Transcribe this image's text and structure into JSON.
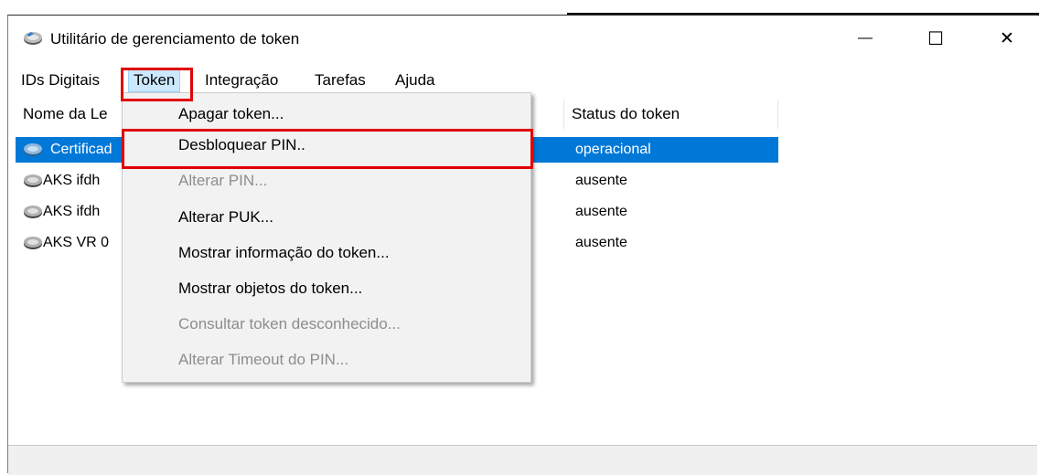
{
  "window": {
    "title": "Utilitário de gerenciamento de token",
    "app_icon": "token-icon",
    "controls": {
      "minimize": "—",
      "maximize": "☐",
      "close": "✕"
    }
  },
  "menubar": {
    "items": [
      {
        "label": "IDs Digitais"
      },
      {
        "label": "Token",
        "active": true
      },
      {
        "label": "Integração"
      },
      {
        "label": "Tarefas"
      },
      {
        "label": "Ajuda"
      }
    ]
  },
  "list": {
    "columns": [
      "Nome da Le",
      "Status do token"
    ],
    "rows": [
      {
        "name": "Certificad",
        "status": "operacional",
        "selected": true
      },
      {
        "name": "AKS ifdh",
        "status": "ausente"
      },
      {
        "name": "AKS ifdh",
        "status": "ausente"
      },
      {
        "name": "AKS VR 0",
        "status": "ausente"
      }
    ]
  },
  "token_menu": {
    "items": [
      {
        "label": "Apagar token...",
        "enabled": true
      },
      {
        "label": "Desbloquear PIN..",
        "enabled": true,
        "highlighted": true
      },
      {
        "label": "Alterar PIN...",
        "enabled": false
      },
      {
        "label": "Alterar PUK...",
        "enabled": true
      },
      {
        "label": "Mostrar informação do token...",
        "enabled": true
      },
      {
        "label": "Mostrar objetos do token...",
        "enabled": true
      },
      {
        "label": "Consultar token desconhecido...",
        "enabled": false
      },
      {
        "label": "Alterar Timeout do PIN...",
        "enabled": false
      }
    ]
  },
  "colors": {
    "selection": "#0078d7",
    "annotation_box": "#e00000",
    "menu_background": "#f2f2f2",
    "disabled_text": "#8d8d8d"
  }
}
